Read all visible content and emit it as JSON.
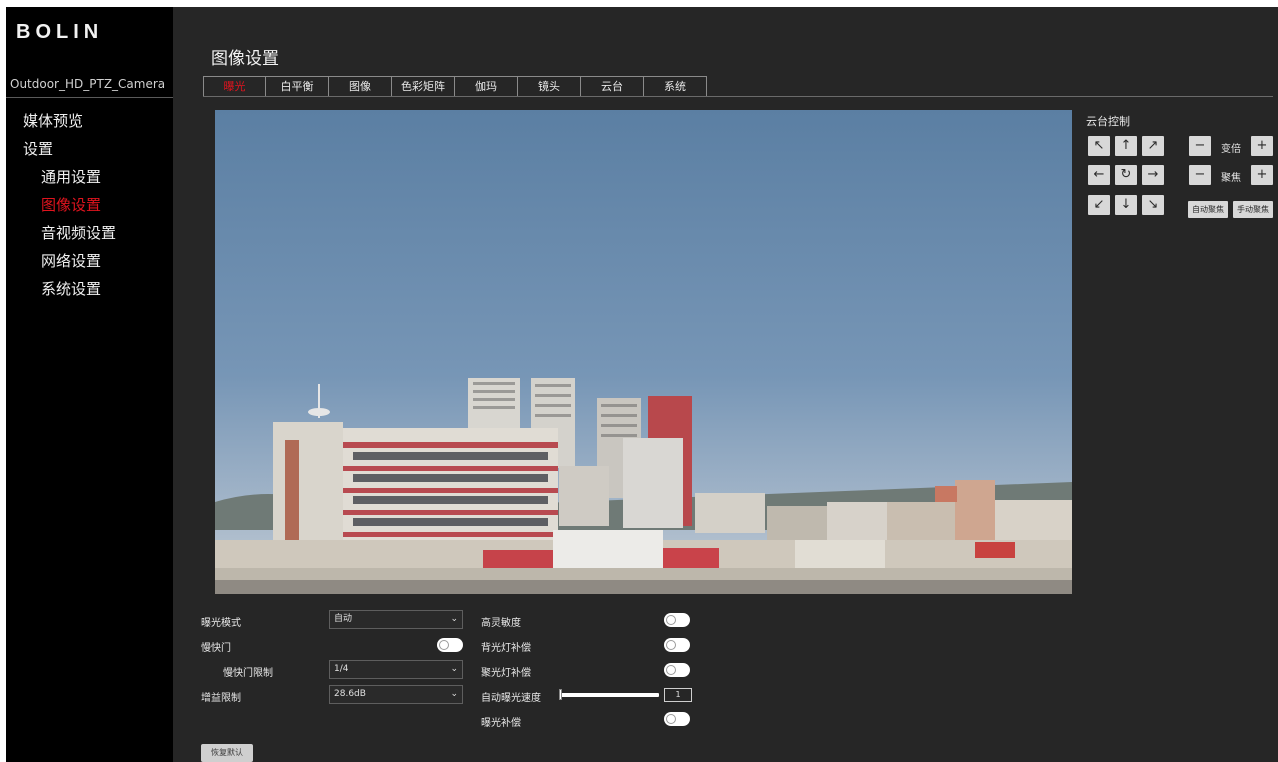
{
  "sidebar": {
    "logo": "BOLIN",
    "device_name": "Outdoor_HD_PTZ_Camera",
    "items": [
      {
        "label": "媒体预览"
      },
      {
        "label": "设置"
      },
      {
        "label": "通用设置"
      },
      {
        "label": "图像设置"
      },
      {
        "label": "音视频设置"
      },
      {
        "label": "网络设置"
      },
      {
        "label": "系统设置"
      }
    ]
  },
  "main": {
    "title": "图像设置",
    "tabs": [
      {
        "label": "曝光"
      },
      {
        "label": "白平衡"
      },
      {
        "label": "图像"
      },
      {
        "label": "色彩矩阵"
      },
      {
        "label": "伽玛"
      },
      {
        "label": "镜头"
      },
      {
        "label": "云台"
      },
      {
        "label": "系统"
      }
    ],
    "active_tab": "曝光"
  },
  "ptz": {
    "title": "云台控制",
    "arrows": {
      "up_left": "↖",
      "up": "↑",
      "up_right": "↗",
      "left": "←",
      "home": "↻",
      "right": "→",
      "down_left": "↙",
      "down": "↓",
      "down_right": "↘"
    },
    "zoom_label": "变倍",
    "focus_label": "聚焦",
    "minus": "−",
    "plus": "+",
    "auto_focus": "自动聚焦",
    "manual_focus": "手动聚焦"
  },
  "exposure": {
    "mode_label": "曝光模式",
    "mode_value": "自动",
    "slow_shutter_label": "慢快门",
    "slow_shutter_limit_label": "慢快门限制",
    "slow_shutter_limit_value": "1/4",
    "gain_limit_label": "增益限制",
    "gain_limit_value": "28.6dB",
    "high_sensitivity_label": "高灵敏度",
    "backlight_label": "背光灯补偿",
    "spotlight_label": "聚光灯补偿",
    "ae_speed_label": "自动曝光速度",
    "ae_speed_value": "1",
    "exposure_comp_label": "曝光补偿",
    "reset_label": "恢复默认"
  },
  "colors": {
    "accent": "#e0141e",
    "sidebar_bg": "#000000",
    "main_bg": "#262626"
  }
}
